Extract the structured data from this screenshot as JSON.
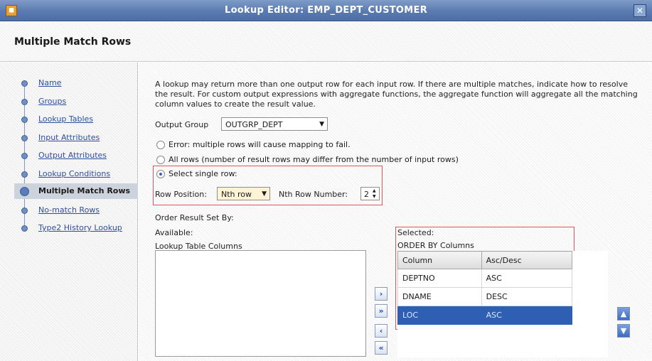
{
  "window": {
    "title": "Lookup Editor: EMP_DEPT_CUSTOMER",
    "close_glyph": "✕"
  },
  "header": {
    "title": "Multiple Match Rows"
  },
  "nav": {
    "items": [
      {
        "label": "Name",
        "selected": false
      },
      {
        "label": "Groups",
        "selected": false
      },
      {
        "label": "Lookup Tables",
        "selected": false
      },
      {
        "label": "Input Attributes",
        "selected": false
      },
      {
        "label": "Output Attributes",
        "selected": false
      },
      {
        "label": "Lookup Conditions",
        "selected": false
      },
      {
        "label": "Multiple Match Rows",
        "selected": true
      },
      {
        "label": "No-match Rows",
        "selected": false
      },
      {
        "label": "Type2 History Lookup",
        "selected": false
      }
    ]
  },
  "main": {
    "description": "A lookup may return more than one output row for each input row. If there are multiple matches, indicate how to resolve the result. For custom output expressions with aggregate functions, the aggregate function will aggregate all the matching column values to create the result value.",
    "output_group_label": "Output Group",
    "output_group_value": "OUTGRP_DEPT",
    "options": [
      {
        "label": "Error: multiple rows will cause mapping to fail.",
        "checked": false
      },
      {
        "label": "All rows (number of result rows may differ from the number of input rows)",
        "checked": false
      },
      {
        "label": "Select single row:",
        "checked": true
      }
    ],
    "row_position_label": "Row Position:",
    "row_position_value": "Nth row",
    "nth_row_label": "Nth Row Number:",
    "nth_row_value": "2",
    "order_by_label": "Order Result Set By:",
    "available_label": "Available:",
    "available_header": "Lookup Table Columns",
    "selected_label": "Selected:",
    "selected_header": "ORDER BY Columns",
    "table": {
      "columns": [
        "Column",
        "Asc/Desc"
      ],
      "rows": [
        {
          "column": "DEPTNO",
          "order": "ASC",
          "selected": false
        },
        {
          "column": "DNAME",
          "order": "DESC",
          "selected": false
        },
        {
          "column": "LOC",
          "order": "ASC",
          "selected": true
        }
      ]
    },
    "shuttle_buttons": [
      {
        "name": "move-right-icon",
        "glyph": "›"
      },
      {
        "name": "move-all-right-icon",
        "glyph": "»"
      },
      {
        "name": "move-left-icon",
        "glyph": "‹"
      },
      {
        "name": "move-all-left-icon",
        "glyph": "«"
      }
    ],
    "reorder_buttons": [
      {
        "name": "move-up-icon",
        "glyph": "▲"
      },
      {
        "name": "move-down-icon",
        "glyph": "▼"
      }
    ],
    "highlight_color": "#e05555",
    "selection_color": "#2f5fb2"
  }
}
